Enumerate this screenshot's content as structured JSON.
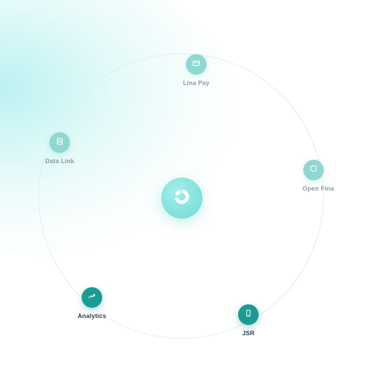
{
  "hub": {
    "icon": "donut-chart-icon"
  },
  "nodes": [
    {
      "id": "lina-pay",
      "label": "Lina Pay",
      "icon": "card-icon",
      "emphasis": "faint"
    },
    {
      "id": "data-link",
      "label": "Data Link",
      "icon": "database-icon",
      "emphasis": "faint"
    },
    {
      "id": "open-finance",
      "label": "Open Fina",
      "icon": "shield-icon",
      "emphasis": "faint"
    },
    {
      "id": "analytics",
      "label": "Analytics",
      "icon": "trend-up-icon",
      "emphasis": "strong"
    },
    {
      "id": "jsr",
      "label": "JSR",
      "icon": "phone-icon",
      "emphasis": "strong"
    }
  ],
  "colors": {
    "accent": "#189c94",
    "accent_light": "#8fd8d2",
    "hub": "#84e2dc",
    "orbit": "#d7f1ef"
  }
}
